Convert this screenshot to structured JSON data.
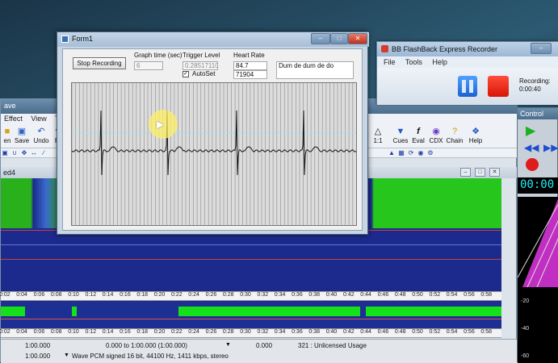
{
  "editor": {
    "title": "ave",
    "menu": [
      "Effect",
      "View",
      "T"
    ],
    "toolbar_left": [
      {
        "label": "en",
        "icon": "open-folder-icon"
      },
      {
        "label": "Save",
        "icon": "save-disk-icon"
      },
      {
        "label": "Undo",
        "icon": "undo-arrow-icon"
      },
      {
        "label": "Re",
        "icon": "redo-arrow-icon"
      }
    ],
    "toolbar_right": [
      {
        "label": "1:1",
        "icon": "zoom-icon"
      },
      {
        "label": "Cues",
        "icon": "cues-icon"
      },
      {
        "label": "Eval",
        "icon": "eval-icon"
      },
      {
        "label": "CDX",
        "icon": "cdx-icon"
      },
      {
        "label": "Chain",
        "icon": "chain-icon"
      },
      {
        "label": "Help",
        "icon": "help-icon"
      }
    ],
    "doc_title": "ed4",
    "ruler_ticks": [
      "0:02",
      "0:04",
      "0:06",
      "0:08",
      "0:10",
      "0:12",
      "0:14",
      "0:16",
      "0:18",
      "0:20",
      "0:22",
      "0:24",
      "0:26",
      "0:28",
      "0:30",
      "0:32",
      "0:34",
      "0:36",
      "0:38",
      "0:40",
      "0:42",
      "0:44",
      "0:46",
      "0:48",
      "0:50",
      "0:52",
      "0:54",
      "0:56",
      "0:58"
    ],
    "status": {
      "zoom1": "1:00.000",
      "range": "0.000 to 1:00.000 (1:00.000)",
      "position": "0.000",
      "license": "321 : Unlicensed Usage",
      "zoom2": "1:00.000",
      "format": "Wave PCM signed 16 bit, 44100 Hz, 1411 kbps, stereo"
    }
  },
  "control_panel": {
    "title": "Control",
    "time": "00:00",
    "meter_labels": [
      "-20",
      "-40",
      "-60"
    ]
  },
  "recorder": {
    "title": "BB FlashBack Express Recorder",
    "menu": [
      "File",
      "Tools",
      "Help"
    ],
    "status_label": "Recording:",
    "elapsed": "0:00:40"
  },
  "form1": {
    "title": "Form1",
    "record_button": "Stop Recording",
    "graph_time_label": "Graph time (sec)",
    "graph_time_value": "6",
    "trigger_label": "Trigger Level",
    "trigger_value": "0.28517110.",
    "autoset_label": "AutoSet",
    "heart_rate_label": "Heart Rate",
    "heart_rate_value": "84.7",
    "heart_rate_value2": "71904",
    "note_text": "Dum de dum de do",
    "colors": {
      "trace": "#111111",
      "grid": "#8a8a8a",
      "trigger_line": "#9fe0f0"
    }
  }
}
